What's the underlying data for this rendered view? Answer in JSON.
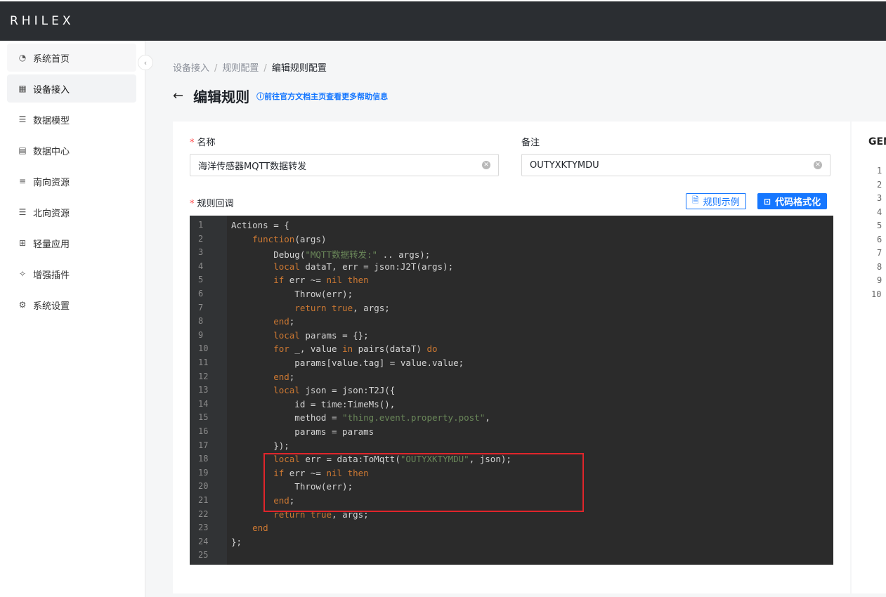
{
  "app": {
    "logo": "RHILEX"
  },
  "sidebar": {
    "items": [
      {
        "label": "系统首页",
        "icon": "dashboard-icon"
      },
      {
        "label": "设备接入",
        "icon": "device-icon"
      },
      {
        "label": "数据模型",
        "icon": "model-icon"
      },
      {
        "label": "数据中心",
        "icon": "database-icon"
      },
      {
        "label": "南向资源",
        "icon": "south-icon"
      },
      {
        "label": "北向资源",
        "icon": "north-icon"
      },
      {
        "label": "轻量应用",
        "icon": "apps-icon"
      },
      {
        "label": "增强插件",
        "icon": "plugin-icon"
      },
      {
        "label": "系统设置",
        "icon": "gear-icon"
      }
    ],
    "active_index": 1
  },
  "breadcrumb": {
    "items": [
      "设备接入",
      "规则配置",
      "编辑规则配置"
    ],
    "separator": "/"
  },
  "page": {
    "title": "编辑规则",
    "help_link": "前往官方文档主页查看更多帮助信息"
  },
  "form": {
    "name_label": "名称",
    "name_value": "海洋传感器MQTT数据转发",
    "remark_label": "备注",
    "remark_value": "OUTYXKTYMDU",
    "callback_label": "规则回调",
    "example_button": "规则示例",
    "format_button": "代码格式化"
  },
  "editor": {
    "line_numbers": [
      "1",
      "2",
      "3",
      "4",
      "5",
      "6",
      "7",
      "8",
      "9",
      "10",
      "11",
      "12",
      "13",
      "14",
      "15",
      "16",
      "17",
      "18",
      "19",
      "20",
      "21",
      "22",
      "23",
      "24",
      "25"
    ]
  },
  "side_panel": {
    "title": "GEN",
    "line_numbers": [
      "1",
      "2",
      "3",
      "4",
      "5",
      "6",
      "7",
      "8",
      "9",
      "10"
    ]
  },
  "colors": {
    "accent": "#1677ff",
    "highlight_border": "#e0252b",
    "editor_bg": "#2b2b2b",
    "keyword": "#cc7832",
    "string": "#6a8759"
  }
}
